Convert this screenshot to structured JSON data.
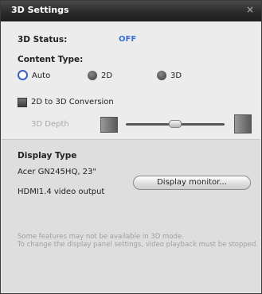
{
  "window": {
    "title": "3D Settings",
    "close_glyph": "×"
  },
  "status": {
    "label": "3D Status:",
    "value": "OFF",
    "value_color": "#3a6fd8"
  },
  "content_type": {
    "label": "Content Type:",
    "options": [
      {
        "label": "Auto",
        "selected": true
      },
      {
        "label": "2D",
        "selected": false
      },
      {
        "label": "3D",
        "selected": false
      }
    ]
  },
  "conversion": {
    "label": "2D to 3D Conversion",
    "checked": false
  },
  "depth": {
    "label": "3D Depth"
  },
  "display": {
    "heading": "Display Type",
    "monitor": "Acer GN245HQ, 23\"",
    "output": "HDMI1.4 video output",
    "button_label": "Display monitor..."
  },
  "notes": {
    "line1": "Some features may not be available in 3D mode.",
    "line2": "To change the display panel settings, video playback must be stopped."
  }
}
